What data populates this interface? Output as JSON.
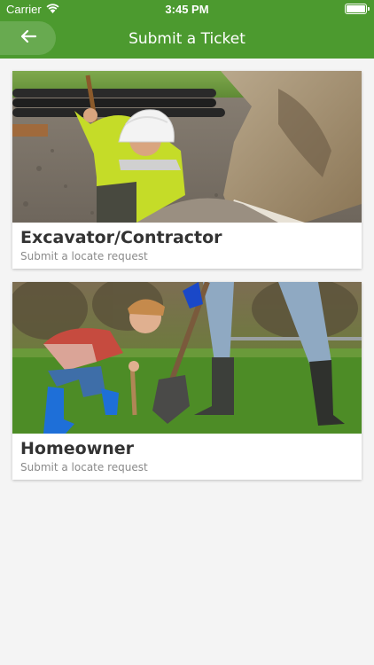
{
  "status_bar": {
    "carrier": "Carrier",
    "time": "3:45 PM"
  },
  "nav": {
    "title": "Submit a Ticket",
    "back_icon": "arrow-left-icon"
  },
  "cards": [
    {
      "title": "Excavator/Contractor",
      "subtitle": "Submit a locate request",
      "image": "worker-digging-with-excavator"
    },
    {
      "title": "Homeowner",
      "subtitle": "Submit a locate request",
      "image": "child-and-adult-digging-with-shovels"
    }
  ],
  "colors": {
    "primary": "#4c9a2f",
    "background": "#f4f4f4",
    "card_title": "#333333",
    "card_subtitle": "#8a8a8a"
  }
}
